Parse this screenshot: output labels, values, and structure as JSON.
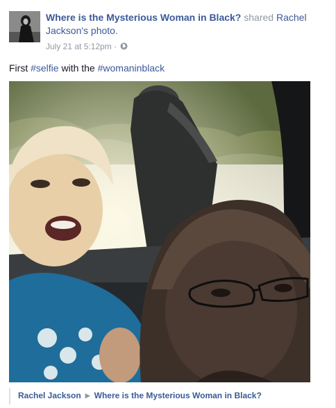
{
  "post": {
    "page_name": "Where is the Mysterious Woman in Black?",
    "shared_text": "shared",
    "shared_owner": "Rachel Jackson's",
    "shared_object": "photo.",
    "timestamp": "July 21 at 5:12pm",
    "separator": "·",
    "privacy_icon": "globe-icon",
    "caption": {
      "prefix": "First ",
      "hashtag1": "#selfie",
      "middle": " with the ",
      "hashtag2": "#womaninblack"
    },
    "photo_icon": "selfie-photo"
  },
  "footer": {
    "author": "Rachel Jackson",
    "arrow_icon": "triangle-right-icon",
    "arrow": "▶",
    "target": "Where is the Mysterious Woman in Black?"
  },
  "colors": {
    "link": "#3b5998",
    "muted": "#9197a3",
    "text": "#141823"
  }
}
